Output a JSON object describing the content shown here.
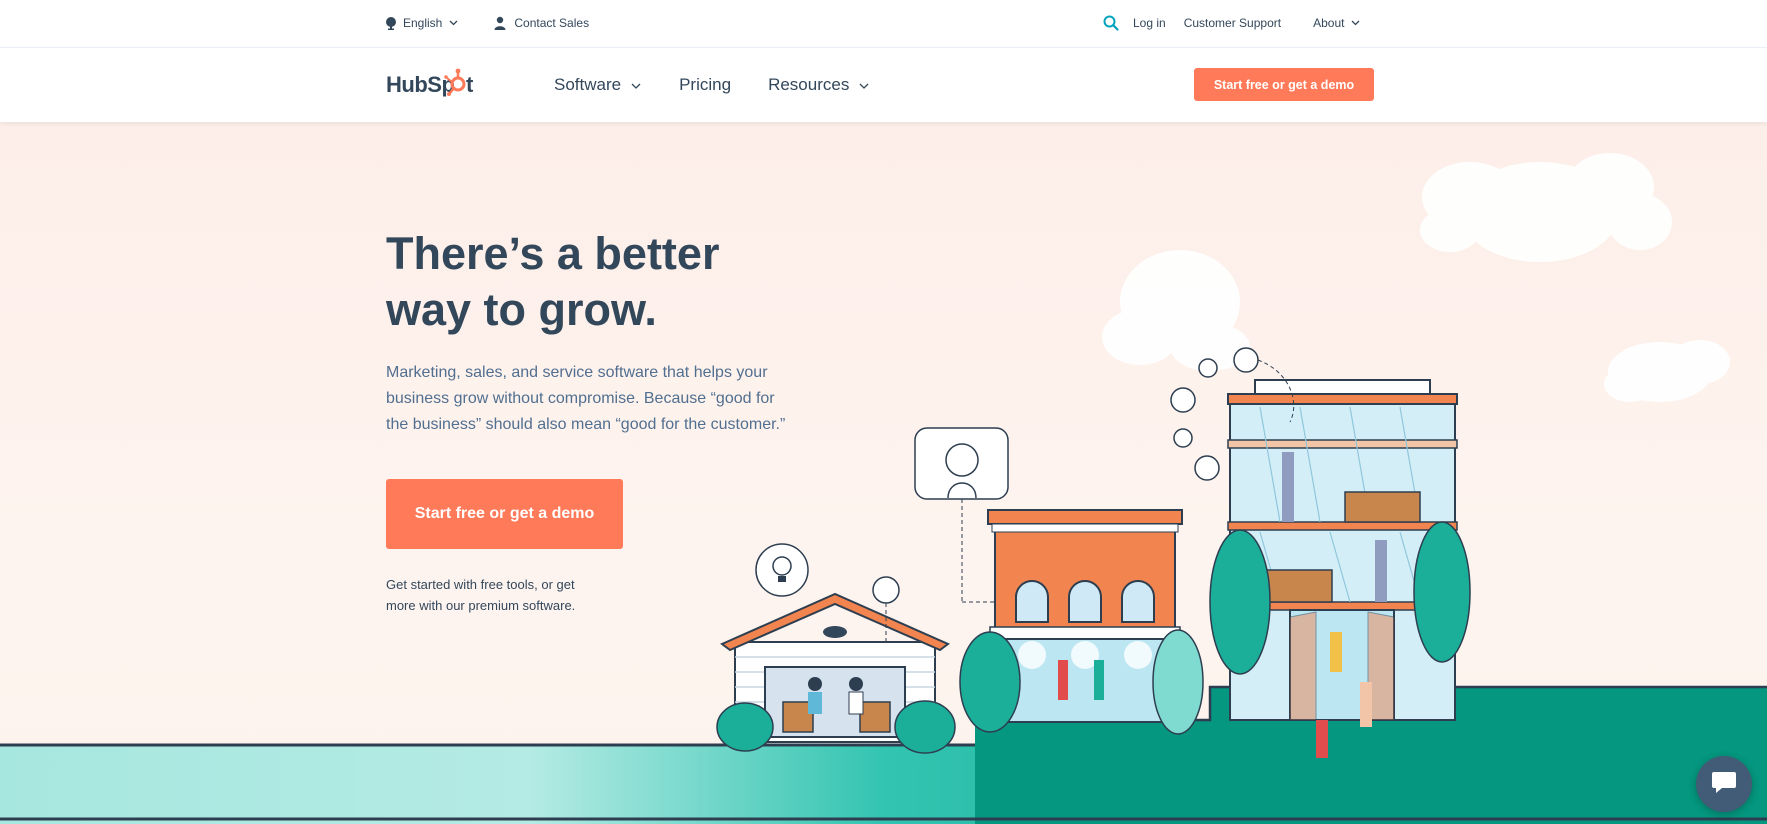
{
  "utility_bar": {
    "language": "English",
    "contact_sales": "Contact Sales",
    "log_in": "Log in",
    "customer_support": "Customer Support",
    "about": "About"
  },
  "nav": {
    "brand": "HubSpot",
    "links": [
      {
        "label": "Software",
        "has_dropdown": true
      },
      {
        "label": "Pricing",
        "has_dropdown": false
      },
      {
        "label": "Resources",
        "has_dropdown": true
      }
    ],
    "cta": "Start free or get a demo"
  },
  "hero": {
    "title_line1": "There’s a better",
    "title_line2": "way to grow.",
    "subtitle": "Marketing, sales, and service software that helps your business grow without compromise. Because “good for the business” should also mean “good for the customer.”",
    "cta": "Start free or get a demo",
    "note": "Get started with free tools, or get more with our premium software."
  },
  "icons": {
    "globe": "globe-icon",
    "person": "person-icon",
    "search": "search-icon",
    "chevron": "chevron-down-icon",
    "chat": "chat-icon"
  },
  "colors": {
    "accent": "#ff7a59",
    "text": "#33475b",
    "teal": "#00bda5",
    "hero_bg": "#fdeee9"
  }
}
